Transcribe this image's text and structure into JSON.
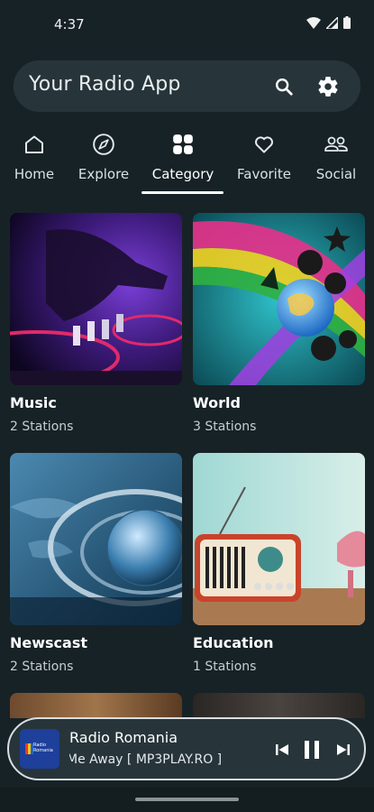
{
  "status_bar": {
    "time": "4:37",
    "icons": [
      "wifi-icon",
      "cellular-signal-icon",
      "battery-icon"
    ]
  },
  "app_bar": {
    "title": "Your Radio App",
    "search_icon": "search-icon",
    "settings_icon": "gear-icon"
  },
  "tabs": [
    {
      "label": "Home",
      "icon": "home-icon",
      "active": false
    },
    {
      "label": "Explore",
      "icon": "compass-icon",
      "active": false
    },
    {
      "label": "Category",
      "icon": "grid-icon",
      "active": true
    },
    {
      "label": "Favorite",
      "icon": "heart-icon",
      "active": false
    },
    {
      "label": "Social",
      "icon": "people-icon",
      "active": false
    }
  ],
  "categories": [
    {
      "title": "Music",
      "subtitle": "2 Stations"
    },
    {
      "title": "World",
      "subtitle": "3 Stations"
    },
    {
      "title": "Newscast",
      "subtitle": "2 Stations"
    },
    {
      "title": "Education",
      "subtitle": "1 Stations"
    }
  ],
  "mini_player": {
    "station": "Radio Romania",
    "now_playing": "Me Away [ MP3PLAY.RO ]",
    "logo_text": "Radio Romania",
    "controls": [
      "skip-previous-icon",
      "pause-icon",
      "skip-next-icon"
    ]
  },
  "colors": {
    "background": "#172226",
    "surface": "#27353a",
    "text": "#ffffff"
  }
}
